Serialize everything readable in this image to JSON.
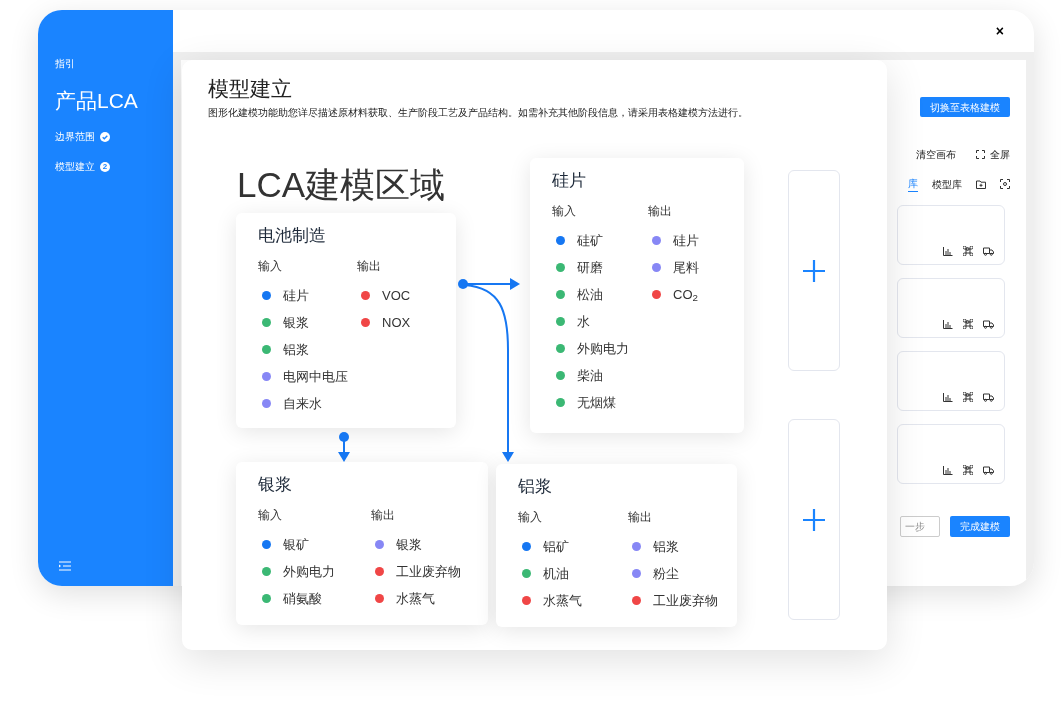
{
  "window": {
    "close": "×"
  },
  "sidebar": {
    "label": "指引",
    "title": "产品LCA",
    "steps": [
      {
        "label": "边界范围",
        "kind": "done"
      },
      {
        "label": "模型建立",
        "kind": "current",
        "number": "2"
      }
    ]
  },
  "header": {
    "title": "模型建立",
    "description": "图形化建模功能助您详尽描述原材料获取、生产阶段工艺及产品结构。如需补充其他阶段信息，请采用表格建模方法进行。",
    "switch_button": "切换至表格建模"
  },
  "toolbar": {
    "clear": "清空画布",
    "fullscreen": "全屏"
  },
  "library_tabs": [
    {
      "label": "库",
      "selected": true
    },
    {
      "label": "模型库",
      "selected": false
    }
  ],
  "footer_buttons": [
    {
      "label": "一步",
      "kind": "secondary"
    },
    {
      "label": "完成建模",
      "kind": "primary"
    }
  ],
  "canvas": {
    "title": "LCA建模区域",
    "nodes": [
      {
        "title": "电池制造",
        "input_label": "输入",
        "output_label": "输出",
        "inputs": [
          {
            "label": "硅片",
            "color": "#1677f2"
          },
          {
            "label": "银浆",
            "color": "#3bb874"
          },
          {
            "label": "铝浆",
            "color": "#3bb874"
          },
          {
            "label": "电网中电压",
            "color": "#8787f5"
          },
          {
            "label": "自来水",
            "color": "#8787f5"
          }
        ],
        "outputs": [
          {
            "label": "VOC",
            "color": "#f04646"
          },
          {
            "label": "NOX",
            "color": "#f04646"
          }
        ]
      },
      {
        "title": "硅片",
        "input_label": "输入",
        "output_label": "输出",
        "inputs": [
          {
            "label": "硅矿",
            "color": "#1677f2"
          },
          {
            "label": "研磨",
            "color": "#3bb874"
          },
          {
            "label": "松油",
            "color": "#3bb874"
          },
          {
            "label": "水",
            "color": "#3bb874"
          },
          {
            "label": "外购电力",
            "color": "#3bb874"
          },
          {
            "label": "柴油",
            "color": "#3bb874"
          },
          {
            "label": "无烟煤",
            "color": "#3bb874"
          }
        ],
        "outputs": [
          {
            "label": "硅片",
            "color": "#8787f5"
          },
          {
            "label": "尾料",
            "color": "#8787f5"
          },
          {
            "label": "CO$_{2}$",
            "color": "#f04646"
          }
        ]
      },
      {
        "title": "银浆",
        "input_label": "输入",
        "output_label": "输出",
        "inputs": [
          {
            "label": "银矿",
            "color": "#1677f2"
          },
          {
            "label": "外购电力",
            "color": "#3bb874"
          },
          {
            "label": "硝氨酸",
            "color": "#3bb874"
          }
        ],
        "outputs": [
          {
            "label": "银浆",
            "color": "#8787f5"
          },
          {
            "label": "工业废弃物",
            "color": "#f04646"
          },
          {
            "label": "水蒸气",
            "color": "#f04646"
          }
        ]
      },
      {
        "title": "铝浆",
        "input_label": "输入",
        "output_label": "输出",
        "inputs": [
          {
            "label": "铝矿",
            "color": "#1677f2"
          },
          {
            "label": "机油",
            "color": "#3bb874"
          },
          {
            "label": "水蒸气",
            "color": "#f04646"
          }
        ],
        "outputs": [
          {
            "label": "铝浆",
            "color": "#8787f5"
          },
          {
            "label": "粉尘",
            "color": "#8787f5"
          },
          {
            "label": "工业废弃物",
            "color": "#f04646"
          }
        ]
      }
    ]
  }
}
